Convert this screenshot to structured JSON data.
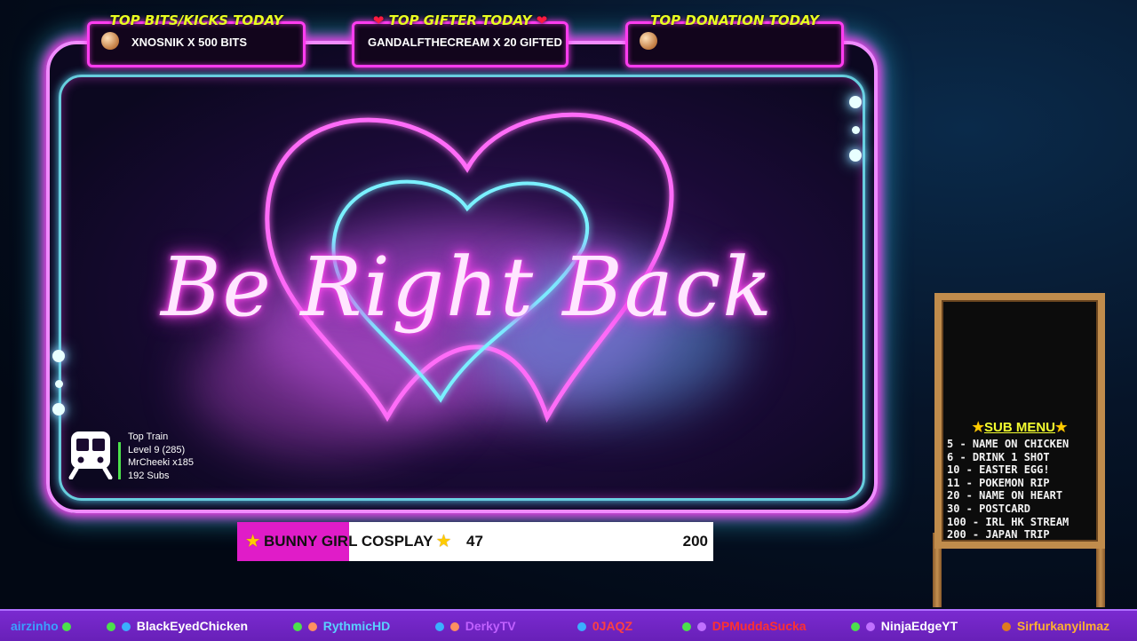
{
  "top_boxes": [
    {
      "title": "TOP BITS/KICKS TODAY",
      "value": "XNOSNIK X 500 BITS"
    },
    {
      "title": "TOP GIFTER TODAY",
      "value": "GANDALFTHECREAM X 20 GIFTED"
    },
    {
      "title": "TOP DONATION TODAY",
      "value": ""
    }
  ],
  "main": {
    "headline": "Be Right Back"
  },
  "train": {
    "title": "Top Train",
    "level": "Level 9  (285)",
    "leader": "MrCheeki x185",
    "subs": "192 Subs"
  },
  "goal": {
    "label": "BUNNY GIRL COSPLAY",
    "current": "47",
    "target": "200",
    "progress_fraction": 0.235,
    "colors": {
      "fill": "#e01cc8",
      "track": "#ffffff"
    }
  },
  "sub_menu": {
    "title": "SUB MENU",
    "items": [
      "5 - NAME ON CHICKEN",
      "6 - DRINK 1 SHOT",
      "10 - EASTER EGG!",
      "11 - POKEMON RIP",
      "20 - NAME ON HEART",
      "30 - POSTCARD",
      "100 - IRL HK STREAM",
      "200 - JAPAN TRIP"
    ]
  },
  "ticker": [
    {
      "name": "airzinho",
      "color": "#3aa0ff"
    },
    {
      "name": "BlackEyedChicken",
      "color": "#ffffff"
    },
    {
      "name": "RythmicHD",
      "color": "#5ad0ff"
    },
    {
      "name": "DerkyTV",
      "color": "#c060ff"
    },
    {
      "name": "0JAQZ",
      "color": "#ff4040"
    },
    {
      "name": "DPMuddaSucka",
      "color": "#ff3030"
    },
    {
      "name": "NinjaEdgeYT",
      "color": "#ffffff"
    },
    {
      "name": "Sirfurkanyilmaz",
      "color": "#ffb030"
    }
  ],
  "colors": {
    "neon_pink": "#ff3cf0",
    "neon_cyan": "#5ae0ff",
    "accent_yellow": "#e8ff20"
  }
}
